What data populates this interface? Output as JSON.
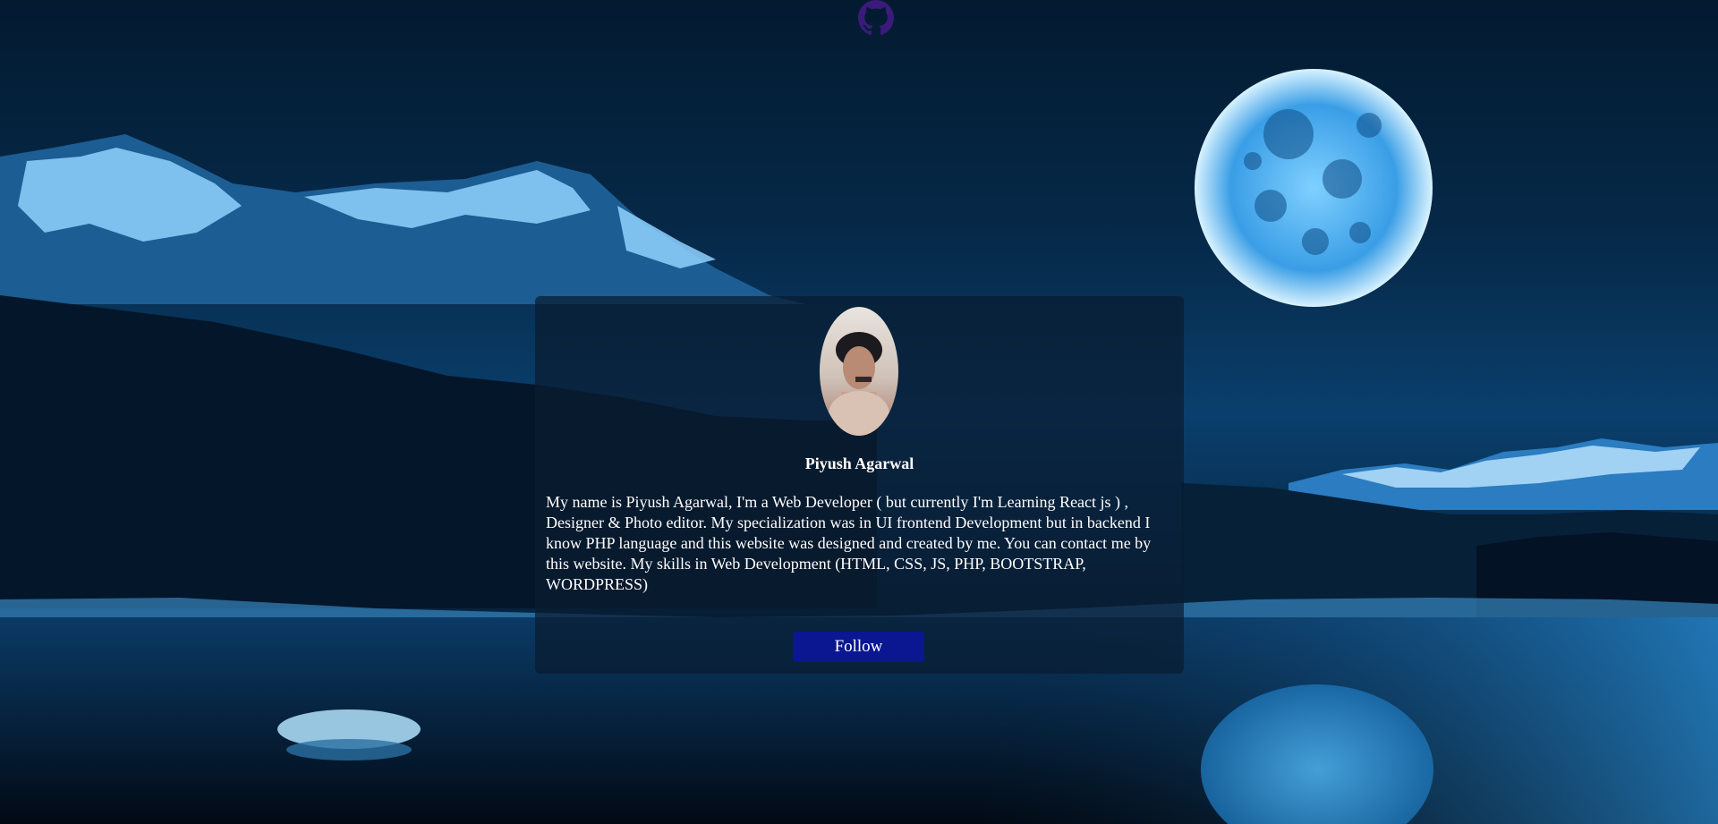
{
  "profile": {
    "name": "Piyush Agarwal",
    "bio": "My name is Piyush Agarwal, I'm a Web Developer ( but currently I'm Learning React js ) , Designer & Photo editor. My specialization was in UI frontend Development but in backend I know PHP language and this website was designed and created by me. You can contact me by this website. My skills in Web Development (HTML, CSS, JS, PHP, BOOTSTRAP, WORDPRESS)",
    "follow_label": "Follow",
    "avatar_icon": "user-photo"
  },
  "header": {
    "icon": "github-icon"
  },
  "colors": {
    "button": "#0a1790",
    "card": "#0a1c30",
    "text": "#ffffff",
    "github_icon": "#3b1b7a"
  }
}
